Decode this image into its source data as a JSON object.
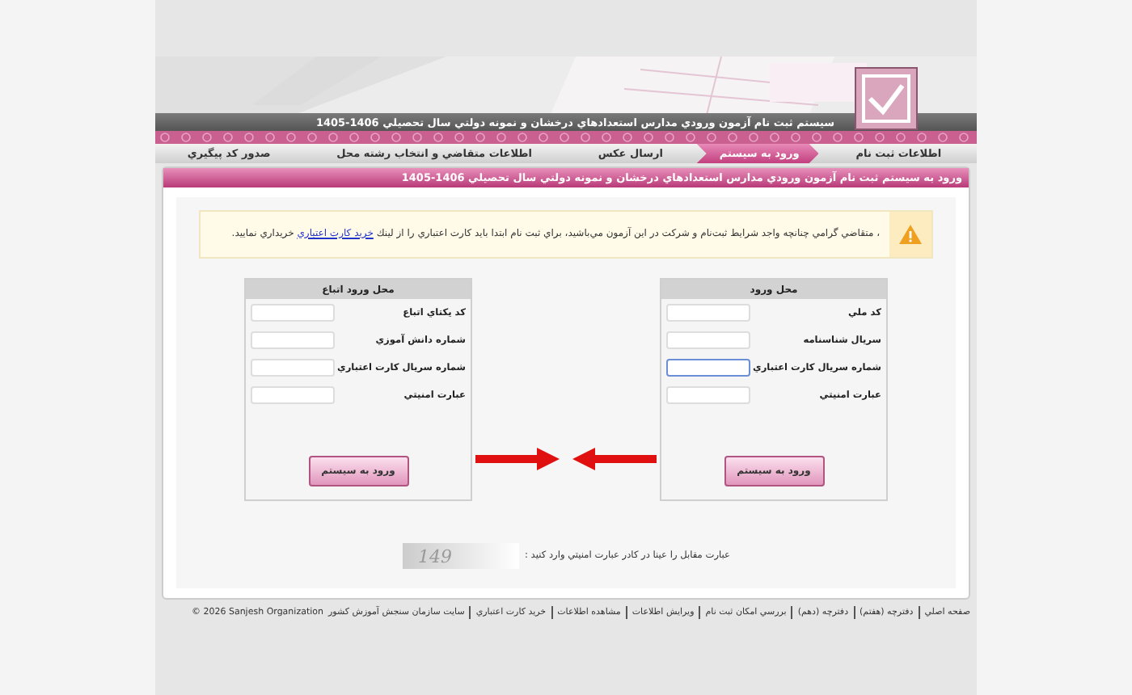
{
  "header": {
    "title": "سيستم ثبت نام آزمون ورودي مدارس استعدادهاي درخشان و نمونه دولتي سال تحصيلي 1406-1405"
  },
  "tabs": [
    {
      "label": "اطلاعات ثبت نام",
      "selected": false
    },
    {
      "label": "ورود به سيستم",
      "selected": true
    },
    {
      "label": "ارسال عكس",
      "selected": false
    },
    {
      "label": "اطلاعات متقاضي و انتخاب رشته محل",
      "selected": false
    },
    {
      "label": "صدور كد پيگيري",
      "selected": false
    }
  ],
  "panel_title": "ورود به سيستم ثبت نام آزمون ورودي مدارس استعدادهاي درخشان و نمونه دولتي سال تحصيلي 1406-1405",
  "notice": {
    "text_before": "، متقاضي گرامي چنانچه واجد شرايط ثبت‌نام و شركت در اين آزمون مي‌باشيد، براي ثبت نام ابتدا بايد كارت اعتباري را از لينك",
    "link": "خريد كارت اعتباري",
    "text_after": "خريداري نماييد."
  },
  "login_panels": [
    {
      "title": "محل ورود",
      "fields": [
        {
          "label": "كد ملي",
          "focused": false
        },
        {
          "label": "سريال شناسنامه",
          "focused": false
        },
        {
          "label": "شماره سريال كارت اعتباري",
          "focused": true
        },
        {
          "label": "عبارت امنيتي",
          "focused": false
        }
      ],
      "button": "ورود به سيستم"
    },
    {
      "title": "محل ورود اتباع",
      "fields": [
        {
          "label": "كد يكتاي اتباع",
          "focused": false
        },
        {
          "label": "شماره دانش آموزي",
          "focused": false
        },
        {
          "label": "شماره سريال كارت اعتباري",
          "focused": false
        },
        {
          "label": "عبارت امنيتي",
          "focused": false
        }
      ],
      "button": "ورود به سيستم"
    }
  ],
  "captcha": {
    "prompt": "عبارت مقابل را عينا در كادر عبارت امنيتي وارد كنيد :",
    "code": "149"
  },
  "footer": {
    "links": [
      "صفحه اصلي",
      "دفترچه (هفتم)",
      "دفترچه (دهم)",
      "بررسي امكان ثبت نام",
      "ويرايش اطلاعات",
      "مشاهده اطلاعات",
      "خريد كارت اعتباري"
    ],
    "org_link": "سايت سازمان سنجش آموزش كشور",
    "copyright": "© 2026 Sanjesh Organization"
  }
}
